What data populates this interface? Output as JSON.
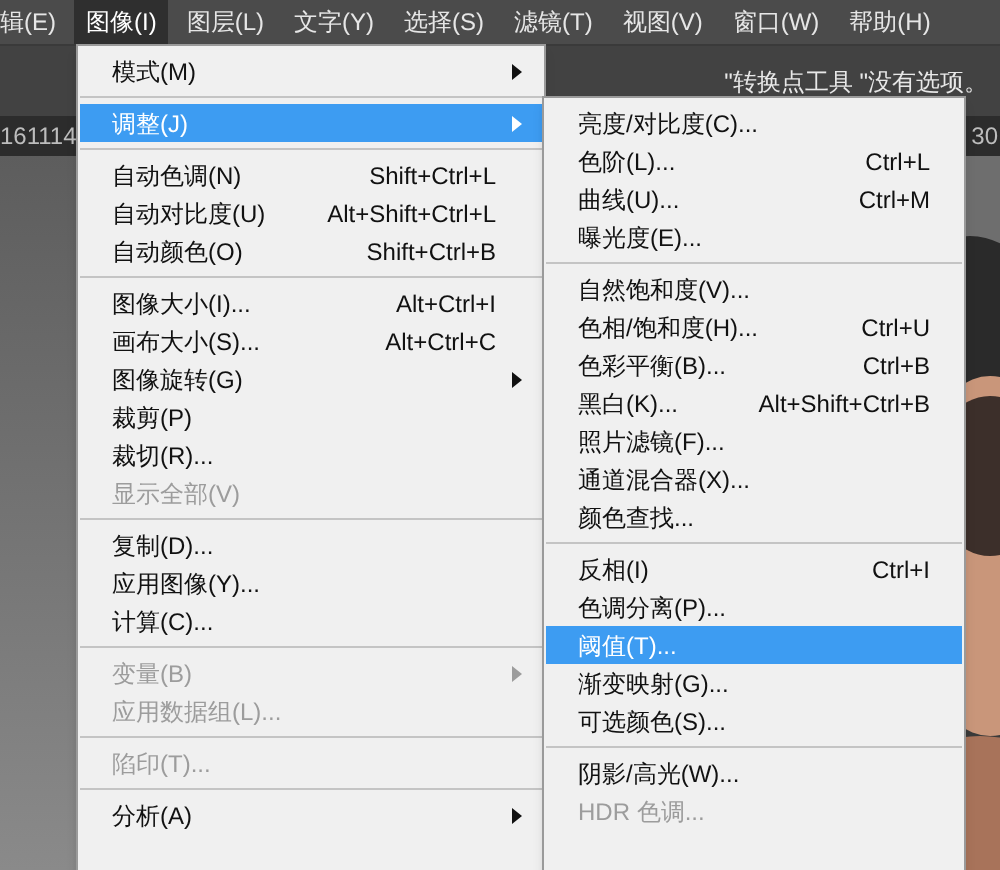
{
  "menu_bar": [
    {
      "label": "辑(E)",
      "selected": false
    },
    {
      "label": "图像(I)",
      "selected": true
    },
    {
      "label": "图层(L)",
      "selected": false
    },
    {
      "label": "文字(Y)",
      "selected": false
    },
    {
      "label": "选择(S)",
      "selected": false
    },
    {
      "label": "滤镜(T)",
      "selected": false
    },
    {
      "label": "视图(V)",
      "selected": false
    },
    {
      "label": "窗口(W)",
      "selected": false
    },
    {
      "label": "帮助(H)",
      "selected": false
    }
  ],
  "options_bar": {
    "hint": "\"转换点工具 \"没有选项。"
  },
  "document_tabs": [
    {
      "label": "161114"
    },
    {
      "label": "30"
    }
  ],
  "image_menu": {
    "groups": [
      [
        {
          "label": "模式(M)",
          "submenu": true,
          "disabled": false,
          "selected": false
        }
      ],
      [
        {
          "label": "调整(J)",
          "submenu": true,
          "disabled": false,
          "selected": true
        }
      ],
      [
        {
          "label": "自动色调(N)",
          "shortcut": "Shift+Ctrl+L",
          "submenu": false,
          "disabled": false,
          "selected": false
        },
        {
          "label": "自动对比度(U)",
          "shortcut": "Alt+Shift+Ctrl+L",
          "submenu": false,
          "disabled": false,
          "selected": false
        },
        {
          "label": "自动颜色(O)",
          "shortcut": "Shift+Ctrl+B",
          "submenu": false,
          "disabled": false,
          "selected": false
        }
      ],
      [
        {
          "label": "图像大小(I)...",
          "shortcut": "Alt+Ctrl+I",
          "submenu": false,
          "disabled": false,
          "selected": false
        },
        {
          "label": "画布大小(S)...",
          "shortcut": "Alt+Ctrl+C",
          "submenu": false,
          "disabled": false,
          "selected": false
        },
        {
          "label": "图像旋转(G)",
          "submenu": true,
          "disabled": false,
          "selected": false
        },
        {
          "label": "裁剪(P)",
          "submenu": false,
          "disabled": false,
          "selected": false
        },
        {
          "label": "裁切(R)...",
          "submenu": false,
          "disabled": false,
          "selected": false
        },
        {
          "label": "显示全部(V)",
          "submenu": false,
          "disabled": true,
          "selected": false
        }
      ],
      [
        {
          "label": "复制(D)...",
          "submenu": false,
          "disabled": false,
          "selected": false
        },
        {
          "label": "应用图像(Y)...",
          "submenu": false,
          "disabled": false,
          "selected": false
        },
        {
          "label": "计算(C)...",
          "submenu": false,
          "disabled": false,
          "selected": false
        }
      ],
      [
        {
          "label": "变量(B)",
          "submenu": true,
          "disabled": true,
          "selected": false
        },
        {
          "label": "应用数据组(L)...",
          "submenu": false,
          "disabled": true,
          "selected": false
        }
      ],
      [
        {
          "label": "陷印(T)...",
          "submenu": false,
          "disabled": true,
          "selected": false
        }
      ],
      [
        {
          "label": "分析(A)",
          "submenu": true,
          "disabled": false,
          "selected": false
        }
      ]
    ]
  },
  "adjust_submenu": {
    "groups": [
      [
        {
          "label": "亮度/对比度(C)...",
          "disabled": false,
          "selected": false
        },
        {
          "label": "色阶(L)...",
          "shortcut": "Ctrl+L",
          "disabled": false,
          "selected": false
        },
        {
          "label": "曲线(U)...",
          "shortcut": "Ctrl+M",
          "disabled": false,
          "selected": false
        },
        {
          "label": "曝光度(E)...",
          "disabled": false,
          "selected": false
        }
      ],
      [
        {
          "label": "自然饱和度(V)...",
          "disabled": false,
          "selected": false
        },
        {
          "label": "色相/饱和度(H)...",
          "shortcut": "Ctrl+U",
          "disabled": false,
          "selected": false
        },
        {
          "label": "色彩平衡(B)...",
          "shortcut": "Ctrl+B",
          "disabled": false,
          "selected": false
        },
        {
          "label": "黑白(K)...",
          "shortcut": "Alt+Shift+Ctrl+B",
          "disabled": false,
          "selected": false
        },
        {
          "label": "照片滤镜(F)...",
          "disabled": false,
          "selected": false
        },
        {
          "label": "通道混合器(X)...",
          "disabled": false,
          "selected": false
        },
        {
          "label": "颜色查找...",
          "disabled": false,
          "selected": false
        }
      ],
      [
        {
          "label": "反相(I)",
          "shortcut": "Ctrl+I",
          "disabled": false,
          "selected": false
        },
        {
          "label": "色调分离(P)...",
          "disabled": false,
          "selected": false
        },
        {
          "label": "阈值(T)...",
          "disabled": false,
          "selected": true
        },
        {
          "label": "渐变映射(G)...",
          "disabled": false,
          "selected": false
        },
        {
          "label": "可选颜色(S)...",
          "disabled": false,
          "selected": false
        }
      ],
      [
        {
          "label": "阴影/高光(W)...",
          "disabled": false,
          "selected": false
        },
        {
          "label": "HDR 色调...",
          "disabled": true,
          "selected": false
        }
      ]
    ]
  }
}
